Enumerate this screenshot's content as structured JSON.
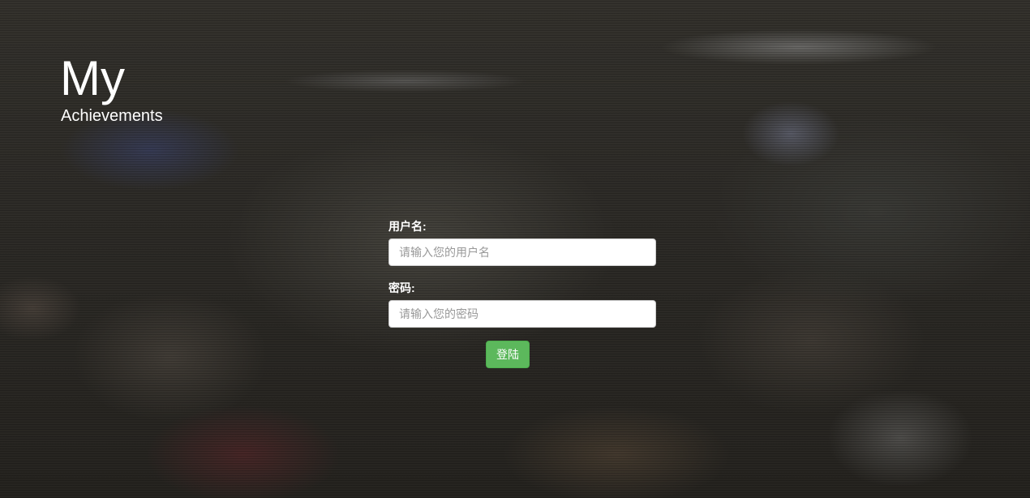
{
  "brand": {
    "title": "My",
    "subtitle": "Achievements"
  },
  "login": {
    "username_label": "用户名:",
    "username_placeholder": "请输入您的用户名",
    "username_value": "",
    "password_label": "密码:",
    "password_placeholder": "请输入您的密码",
    "password_value": "",
    "submit_label": "登陆"
  },
  "colors": {
    "button_bg": "#5cb85c",
    "text": "#ffffff"
  }
}
